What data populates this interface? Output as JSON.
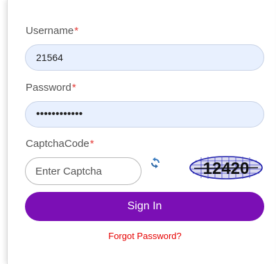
{
  "form": {
    "username_label": "Username",
    "username_value": "21564",
    "password_label": "Password",
    "password_value": "••••••••••••",
    "captcha_label": "CaptchaCode",
    "required_marker": "*",
    "captcha_placeholder": "Enter Captcha",
    "captcha_image_text": "12420",
    "signin_label": "Sign In",
    "forgot_label": "Forgot Password?",
    "refresh_icon": "refresh-icon"
  },
  "colors": {
    "accent": "#7b0fb5",
    "required": "#e53935",
    "link": "#e60000",
    "field_bg": "#e8f0fe"
  }
}
